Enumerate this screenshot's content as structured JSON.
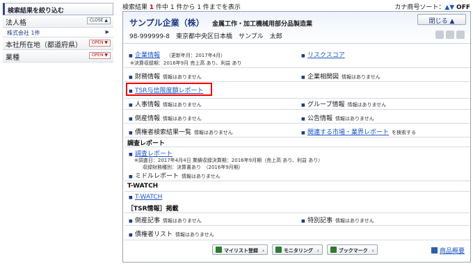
{
  "filter": {
    "title": "検索結果を絞り込む",
    "groups": [
      {
        "label": "法人格",
        "toggle": "CLOSE",
        "sub": [
          {
            "label": "株式会社 1件"
          }
        ]
      },
      {
        "label": "本社所在地（都道府県）",
        "toggle": "OPEN"
      },
      {
        "label": "業種",
        "toggle": "OPEN"
      }
    ]
  },
  "topbar": {
    "prefix": "検索結果",
    "count": "1",
    "suffix": "件中 1 件から 1 件までを表示",
    "sort_label": "カナ商号ソート：",
    "sort_asc": "▲",
    "sort_desc": "▼",
    "sort_off": "OFF"
  },
  "company": {
    "name": "サンプル企業（株）",
    "industry": "金属工作・加工機械用部分品製造業",
    "address": "98-999999-8　東京都中央区日本橋　サンプル　太郎",
    "close_label": "閉じる ▲"
  },
  "items": {
    "corp_info": {
      "label": "企業情報",
      "updated": "（更新年月：2017年4月）",
      "note": "※決算収録期：2016年9月 売上高 あり、利益 あり"
    },
    "risk_score": {
      "label": "リスクスコア"
    },
    "finance": {
      "label": "財務情報",
      "na": "情報はありません"
    },
    "relations": {
      "label": "企業相関図",
      "na": "情報はありません"
    },
    "tsr_report": {
      "label": "TSR与信限度額レポート"
    },
    "personnel": {
      "label": "人事情報",
      "na": "情報はありません"
    },
    "group": {
      "label": "グループ情報",
      "na": "情報はありません"
    },
    "bankruptcy": {
      "label": "倒産情報",
      "na": "情報はありません"
    },
    "gazette": {
      "label": "公告情報",
      "na": "情報はありません"
    },
    "debtor_search": {
      "label": "債権者検索結果一覧",
      "na": "情報はありません"
    },
    "market_report": {
      "label": "関連する市場・業界レポート",
      "suffix": "を検索する"
    }
  },
  "sections": {
    "survey": {
      "title": "調査レポート",
      "report_link": "調査レポート",
      "note1": "※調査日：2017年4月4日 業績収録決算期：2016年9月期（売上高 あり、利益 あり）",
      "note2": "収録財務種別：決算書あり　（2016年9月期）",
      "middle": {
        "label": "ミドルレポート",
        "na": "情報はありません"
      }
    },
    "twatch": {
      "title": "T-WATCH",
      "link": "T-WATCH"
    },
    "tsr": {
      "title": "［TSR情報］掲載",
      "bankruptcy_article": {
        "label": "倒産記事",
        "na": "情報はありません"
      },
      "special_article": {
        "label": "特別記事",
        "na": "情報はありません"
      },
      "debtor_list": {
        "label": "債権者リスト",
        "na": "情報はありません"
      }
    }
  },
  "buttons": {
    "mylist": "マイリスト登録",
    "monitoring": "モニタリング",
    "bookmark": "ブックマーク",
    "overview": "商品概要"
  }
}
